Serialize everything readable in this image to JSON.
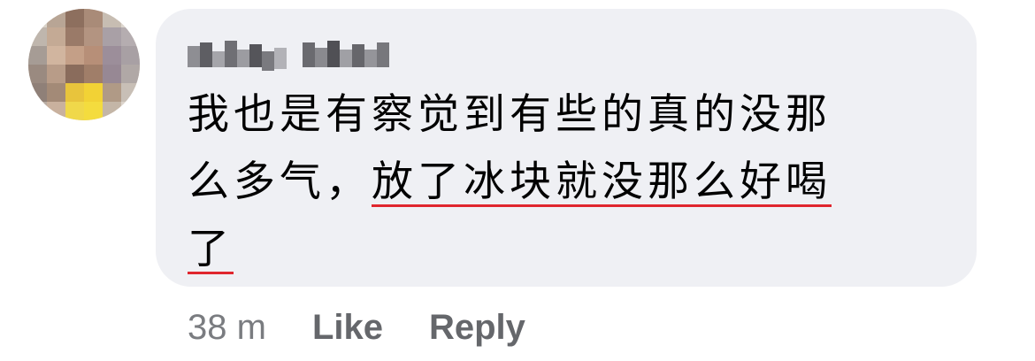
{
  "comment": {
    "avatar": {
      "icon": "blurred-profile-photo"
    },
    "author": {
      "name_redacted": true
    },
    "text_lines": [
      {
        "plain": "我也是有察觉到有些的真的没那",
        "underlined": ""
      },
      {
        "plain": "么多气，",
        "underlined": "放了冰块就没那么好喝"
      },
      {
        "plain": "",
        "underlined": "了"
      }
    ],
    "bubble_color": "#eff0f4",
    "underline_color": "#e0262e"
  },
  "actions": {
    "timestamp": "38 m",
    "like_label": "Like",
    "reply_label": "Reply"
  }
}
